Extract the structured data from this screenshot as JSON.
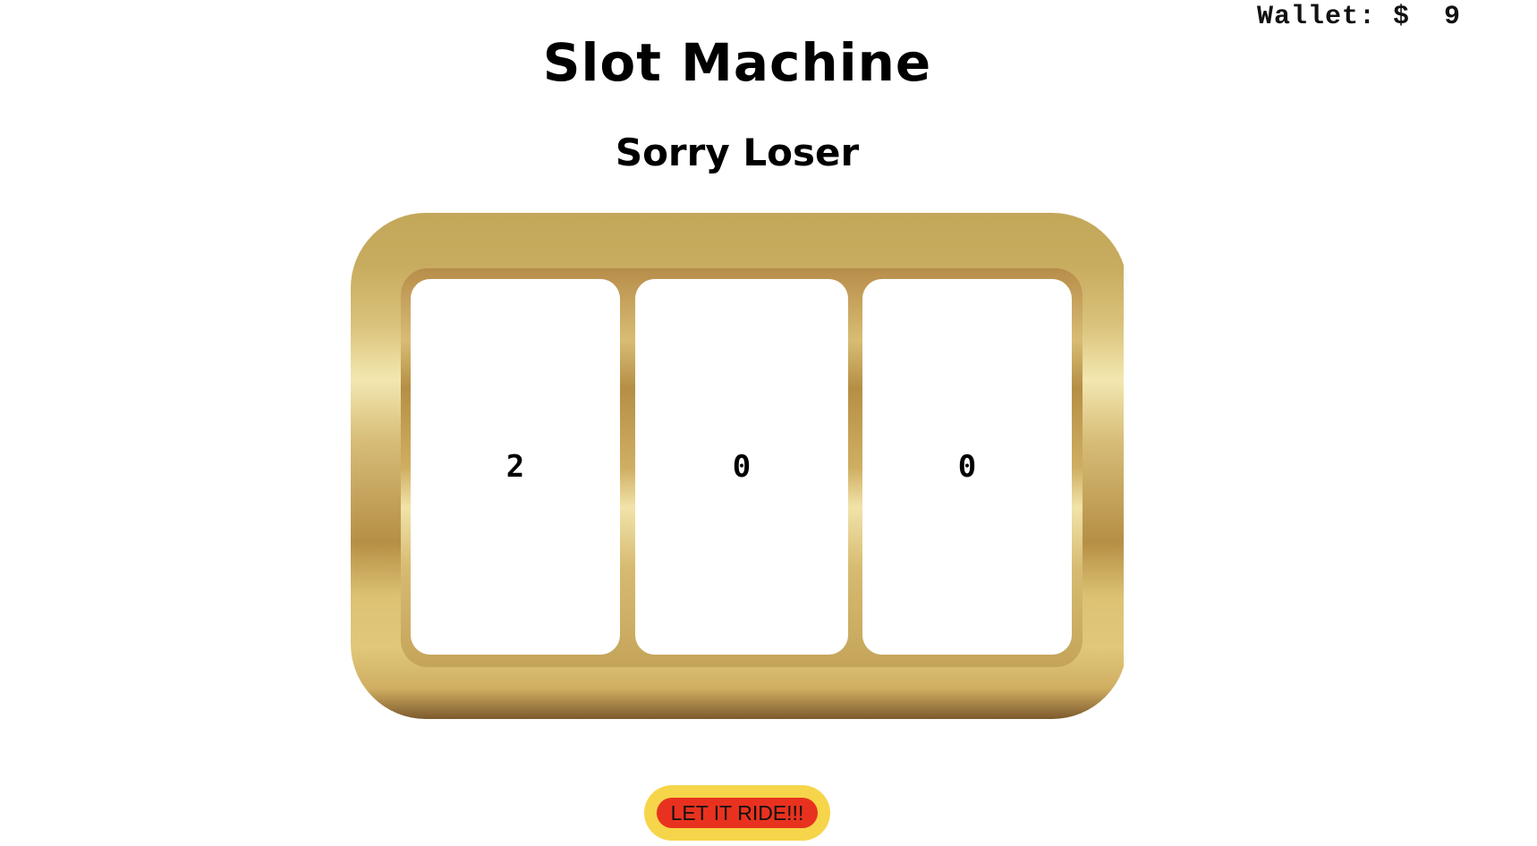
{
  "wallet": {
    "label": "Wallet: $  9"
  },
  "header": {
    "title": "Slot Machine",
    "status": "Sorry Loser"
  },
  "reels": [
    {
      "value": "2"
    },
    {
      "value": "0"
    },
    {
      "value": "0"
    }
  ],
  "controls": {
    "spin_label": "LET IT RIDE!!!"
  },
  "colors": {
    "frame_gold": "#c3a75a",
    "button_outer": "#f6d54a",
    "button_inner": "#e8321f"
  }
}
